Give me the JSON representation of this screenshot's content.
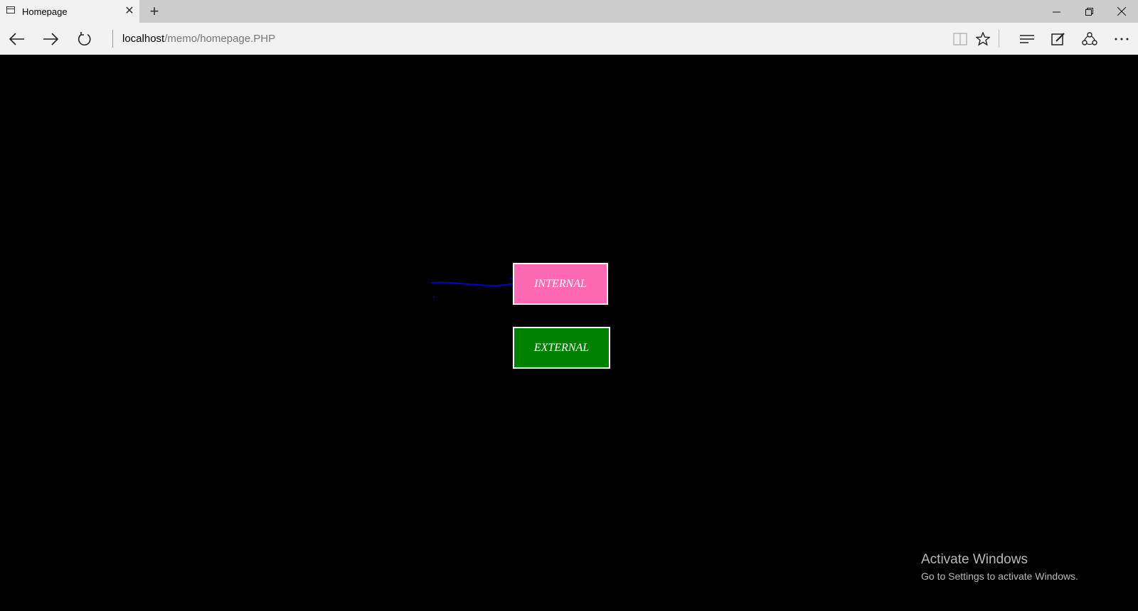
{
  "tab": {
    "title": "Homepage",
    "close_glyph": "✕",
    "new_tab_glyph": "+"
  },
  "window_controls": {
    "minimize_glyph": "—",
    "restore_glyph": "❐",
    "close_glyph": "✕"
  },
  "address_bar": {
    "host": "localhost",
    "path": "/memo/homepage.PHP"
  },
  "toolbar_icons": [
    "reading-view-icon",
    "favorite-star-icon",
    "hub-icon",
    "web-note-icon",
    "share-icon",
    "more-icon"
  ],
  "page": {
    "internal_label": "INTERNAL",
    "external_label": "EXTERNAL",
    "internal_color": "#ff69b4",
    "external_color": "#008000",
    "arrow_color": "#0000cc"
  },
  "watermark": {
    "title": "Activate Windows",
    "subtitle": "Go to Settings to activate Windows."
  }
}
